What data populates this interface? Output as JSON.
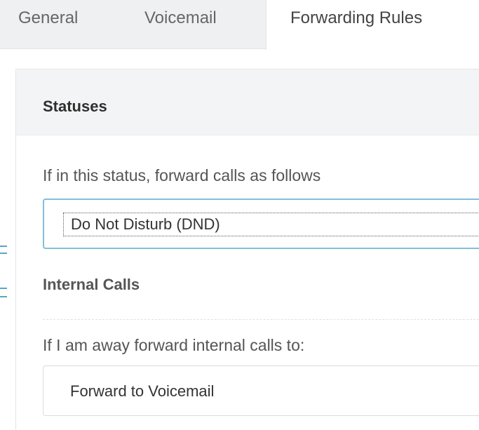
{
  "tabs": [
    {
      "label": "General",
      "selected": false
    },
    {
      "label": "Voicemail",
      "selected": false
    },
    {
      "label": "Forwarding Rules",
      "selected": true
    }
  ],
  "panel": {
    "title": "Statuses",
    "status_label": "If in this status, forward calls as follows",
    "status_select": {
      "value": "Do Not Disturb (DND)"
    },
    "internal_section_title": "Internal Calls",
    "internal_away_label": "If I am away forward internal calls to:",
    "internal_select": {
      "value": "Forward to Voicemail"
    }
  },
  "colors": {
    "tab_bar_bg": "#eef0f1",
    "focus_border": "#7fc0d7",
    "panel_header_bg": "#f3f4f5"
  }
}
